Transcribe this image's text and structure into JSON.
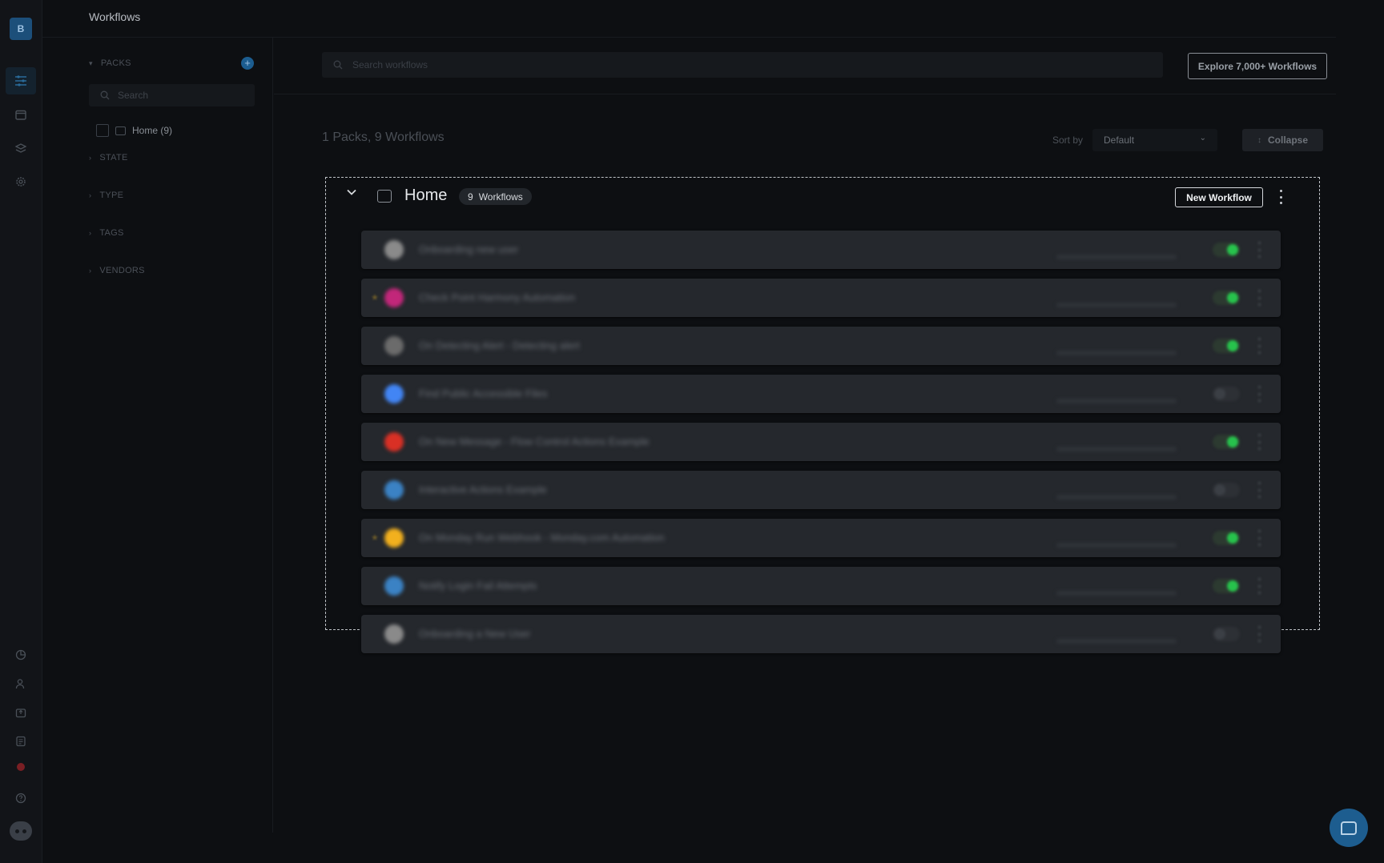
{
  "app": {
    "logo_letter": "B"
  },
  "header": {
    "title": "Workflows"
  },
  "rail": {
    "icons": [
      "workflows-icon",
      "calendar-icon",
      "layers-icon",
      "settings-icon",
      "analytics-icon",
      "users-icon",
      "export-icon",
      "logs-icon",
      "notification-icon",
      "help-icon",
      "chatbot-icon"
    ]
  },
  "filters": {
    "packs_label": "PACKS",
    "search_placeholder": "Search",
    "pack_item": "Home (9)",
    "state_label": "STATE",
    "type_label": "TYPE",
    "tags_label": "TAGS",
    "vendors_label": "VENDORS"
  },
  "toolbar": {
    "search_placeholder": "Search workflows",
    "explore_label": "Explore 7,000+ Workflows",
    "summary": "1 Packs, 9 Workflows",
    "sort_label": "Sort by",
    "sort_value": "Default",
    "collapse_label": "Collapse"
  },
  "pack": {
    "name": "Home",
    "count": "9",
    "count_label": "Workflows",
    "new_workflow_label": "New Workflow"
  },
  "workflows": [
    {
      "name": "Onboarding new user",
      "enabled": true,
      "starred": false,
      "icon_color": "#8a8a8a"
    },
    {
      "name": "Check Point Harmony Automation",
      "enabled": true,
      "starred": true,
      "icon_color": "#c2277a"
    },
    {
      "name": "On Detecting Alert - Detecting alert",
      "enabled": true,
      "starred": false,
      "icon_color": "#6b6b6b"
    },
    {
      "name": "Find Public Accessible Files",
      "enabled": false,
      "starred": false,
      "icon_color": "#4285f4"
    },
    {
      "name": "On New Message - Flow Control Actions Example",
      "enabled": true,
      "starred": false,
      "icon_color": "#d93025"
    },
    {
      "name": "Interactive Actions Example",
      "enabled": false,
      "starred": false,
      "icon_color": "#3b82c4"
    },
    {
      "name": "On Monday Run Webhook - Monday.com Automation",
      "enabled": true,
      "starred": true,
      "icon_color": "#f2b01e"
    },
    {
      "name": "Notify Login Fail Attempts",
      "enabled": true,
      "starred": false,
      "icon_color": "#3b82c4"
    },
    {
      "name": "Onboarding a New User",
      "enabled": false,
      "starred": false,
      "icon_color": "#8a8a8a"
    }
  ]
}
